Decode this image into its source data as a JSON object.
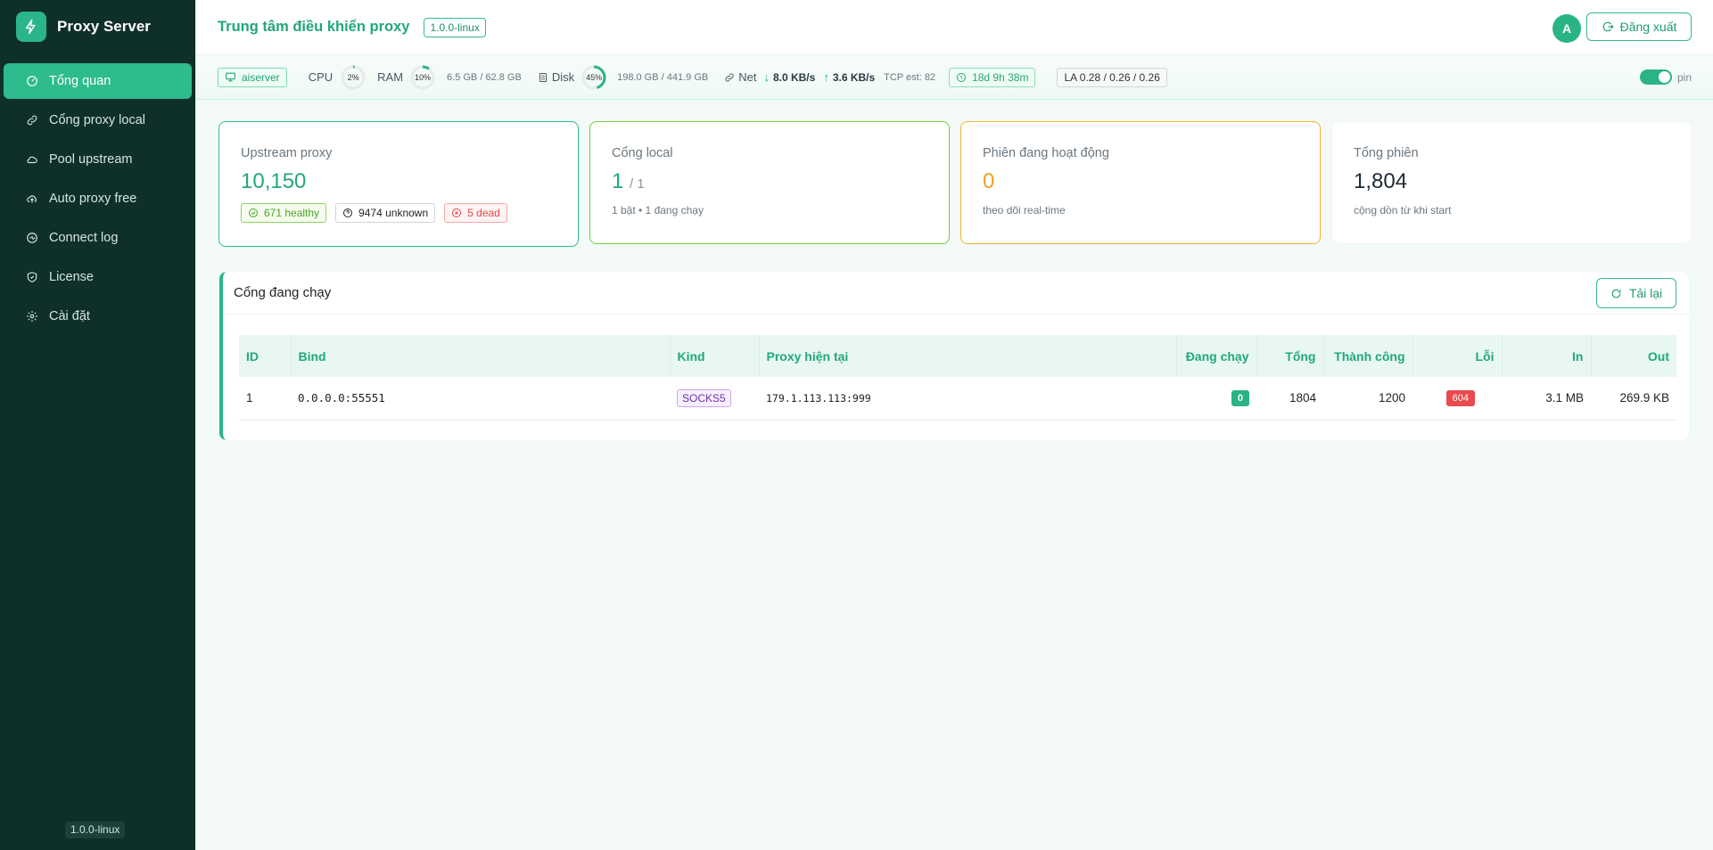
{
  "app": {
    "name": "Proxy Server",
    "logo_icon": "bolt-icon"
  },
  "sidebar": {
    "items": [
      {
        "label": "Tổng quan",
        "icon": "dashboard-icon",
        "active": true
      },
      {
        "label": "Cổng proxy local",
        "icon": "link-icon"
      },
      {
        "label": "Pool upstream",
        "icon": "cloud-icon"
      },
      {
        "label": "Auto proxy free",
        "icon": "cloud-upload-icon"
      },
      {
        "label": "Connect log",
        "icon": "activity-icon"
      },
      {
        "label": "License",
        "icon": "shield-icon"
      },
      {
        "label": "Cài đặt",
        "icon": "gear-icon"
      }
    ],
    "version": "1.0.0-linux"
  },
  "header": {
    "title": "Trung tâm điều khiển proxy",
    "version_badge": "1.0.0-linux",
    "avatar_letter": "A",
    "logout_label": "Đăng xuất"
  },
  "status": {
    "host": "aiserver",
    "cpu_label": "CPU",
    "cpu_percent": "2%",
    "cpu_value": 2,
    "ram_label": "RAM",
    "ram_percent": "10%",
    "ram_value": 10,
    "ram_detail": "6.5 GB / 62.8 GB",
    "disk_label": "Disk",
    "disk_percent": "45%",
    "disk_value": 45,
    "disk_detail": "198.0 GB / 441.9 GB",
    "net_label": "Net",
    "net_down": "8.0 KB/s",
    "net_up": "3.6 KB/s",
    "tcp": "TCP est: 82",
    "uptime": "18d 9h 38m",
    "load_avg": "LA 0.28 / 0.26 / 0.26",
    "pin_label": "pin"
  },
  "cards": {
    "upstream": {
      "label": "Upstream proxy",
      "value": "10,150",
      "healthy": "671 healthy",
      "unknown": "9474 unknown",
      "dead": "5 dead"
    },
    "local": {
      "label": "Cổng local",
      "value": "1",
      "total": "/ 1",
      "sub": "1 bật • 1 đang chạy"
    },
    "active": {
      "label": "Phiên đang hoạt động",
      "value": "0",
      "sub": "theo dõi real-time"
    },
    "total": {
      "label": "Tổng phiên",
      "value": "1,804",
      "sub": "cộng dồn từ khi start"
    }
  },
  "ports_panel": {
    "title": "Cổng đang chạy",
    "reload_label": "Tải lại",
    "columns": [
      "ID",
      "Bind",
      "Kind",
      "Proxy hiện tại",
      "Đang chạy",
      "Tổng",
      "Thành công",
      "Lỗi",
      "In",
      "Out"
    ],
    "rows": [
      {
        "id": "1",
        "bind": "0.0.0.0:55551",
        "kind": "SOCKS5",
        "proxy": "179.1.113.113:999",
        "running": "0",
        "total": "1804",
        "success": "1200",
        "errors": "604",
        "in": "3.1 MB",
        "out": "269.9 KB"
      }
    ]
  },
  "colors": {
    "accent": "#2ebb8e",
    "sidebar_bg": "#0f2f29",
    "error": "#e84a4f",
    "warning": "#f0a020",
    "purple": "#6c2fa8"
  }
}
